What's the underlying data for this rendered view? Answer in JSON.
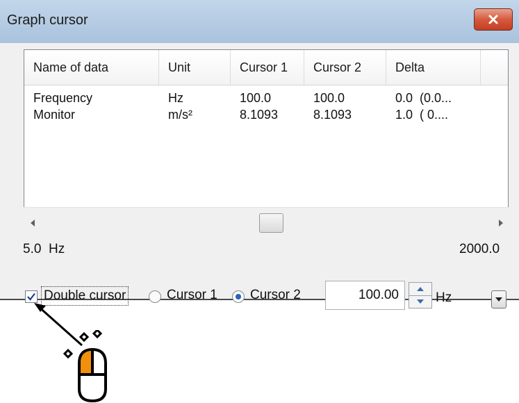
{
  "window": {
    "title": "Graph cursor",
    "close_icon": "close-x-icon"
  },
  "list": {
    "columns": [
      "Name of data",
      "Unit",
      "Cursor 1",
      "Cursor 2",
      "Delta"
    ],
    "rows": [
      {
        "name": "Frequency",
        "unit": "Hz",
        "cursor1": "100.0",
        "cursor2": "100.0",
        "delta": "0.0  (0.0..."
      },
      {
        "name": "Monitor",
        "unit": "m/s²",
        "cursor1": "8.1093",
        "cursor2": "8.1093",
        "delta": "1.0  ( 0...."
      }
    ]
  },
  "scrollbar": {
    "left_arrow": "arrow-left-icon",
    "right_arrow": "arrow-right-icon"
  },
  "range": {
    "min": "5.0  Hz",
    "max": "2000.0"
  },
  "controls": {
    "double_cursor_label": "Double cursor",
    "double_cursor_checked": true,
    "cursor1_label": "Cursor 1",
    "cursor2_label": "Cursor 2",
    "selected_cursor": "Cursor 2",
    "value": "100.00",
    "unit": "Hz"
  },
  "annotation": {
    "mouse_icon": "mouse-left-click-icon",
    "arrow_icon": "pointer-arrow-icon"
  },
  "colors": {
    "titlebar": "#b4cbe3",
    "close_button": "#d65a3e",
    "radio_selected": "#2a64b8",
    "mouse_left_button": "#f0900c"
  }
}
